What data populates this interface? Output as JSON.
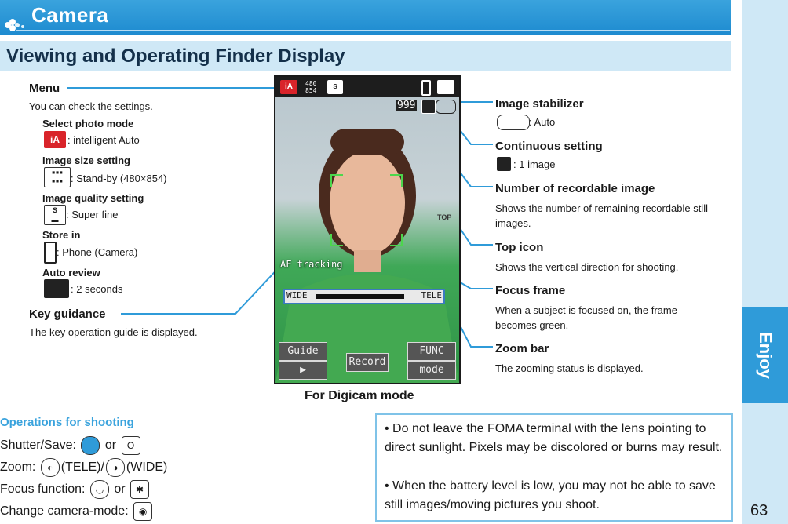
{
  "header": {
    "title": "Camera",
    "section_title": "Viewing and Operating Finder Display"
  },
  "side_tab": {
    "label": "Enjoy"
  },
  "page_number": "63",
  "left_callouts": {
    "menu": {
      "title": "Menu",
      "desc": "You can check the settings.",
      "items": [
        {
          "label": "Select photo mode",
          "value": ": intelligent Auto"
        },
        {
          "label": "Image size setting",
          "value": ": Stand-by (480×854)"
        },
        {
          "label": "Image quality setting",
          "value": ": Super fine"
        },
        {
          "label": "Store in",
          "value": ": Phone (Camera)"
        },
        {
          "label": "Auto review",
          "value": ": 2 seconds"
        }
      ]
    },
    "key_guidance": {
      "title": "Key guidance",
      "desc": "The key operation guide is displayed."
    }
  },
  "right_callouts": [
    {
      "title": "Image stabilizer",
      "desc": ": Auto"
    },
    {
      "title": "Continuous setting",
      "desc": ": 1 image"
    },
    {
      "title": "Number of recordable image",
      "desc": "Shows the number of remaining recordable still images."
    },
    {
      "title": "Top icon",
      "desc": "Shows the vertical direction for shooting."
    },
    {
      "title": "Focus frame",
      "desc": "When a subject is focused on, the frame becomes green."
    },
    {
      "title": "Zoom bar",
      "desc": "The zooming status is displayed."
    }
  ],
  "screen": {
    "status_size": "480\n854",
    "count": "999",
    "af_label": "AF tracking",
    "zoom_wide": "WIDE",
    "zoom_tele": "TELE",
    "top_label": "TOP",
    "buttons": {
      "guide": "Guide",
      "func": "FUNC",
      "record": "Record",
      "mode": "mode",
      "play": "▶"
    }
  },
  "caption": "For Digicam mode",
  "operations": {
    "title": "Operations for shooting",
    "lines": [
      {
        "label": "Shutter/Save:",
        "mid": " or ",
        "tail": ""
      },
      {
        "label": "Zoom:",
        "mid": "(TELE)/",
        "tail": "(WIDE)"
      },
      {
        "label": "Focus function:",
        "mid": " or ",
        "tail": ""
      },
      {
        "label": "Change camera-mode:",
        "mid": "",
        "tail": ""
      }
    ]
  },
  "notes": [
    "• Do not leave the FOMA terminal with the lens pointing to direct sunlight. Pixels may be discolored or burns may result.",
    "• When the battery level is low, you may not be able to save still images/moving pictures you shoot."
  ],
  "colors": {
    "accent": "#2f9bd9",
    "band": "#cfe8f6",
    "focus": "#4cd64c",
    "line": "#2f9bd9"
  }
}
